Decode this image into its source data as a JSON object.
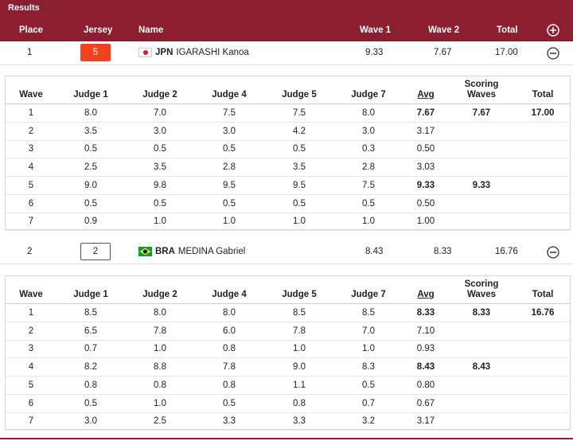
{
  "results_bar": {
    "title": "Results",
    "headers": {
      "place": "Place",
      "jersey": "Jersey",
      "name": "Name",
      "wave1": "Wave 1",
      "wave2": "Wave 2",
      "total": "Total"
    },
    "accent_color": "#8b1f30"
  },
  "athletes": [
    {
      "place": "1",
      "jersey": "5",
      "jersey_color": "#f5401e",
      "flag": "jpn-flag-icon",
      "noc": "JPN",
      "name": "IGARASHI Kanoa",
      "wave1": "9.33",
      "wave2": "7.67",
      "total": "17.00",
      "detail": {
        "headers": {
          "wave": "Wave",
          "j1": "Judge 1",
          "j2": "Judge 2",
          "j4": "Judge 4",
          "j5": "Judge 5",
          "j7": "Judge 7",
          "avg": "Avg",
          "scoring_line1": "Scoring",
          "scoring_line2": "Waves",
          "total": "Total"
        },
        "rows": [
          {
            "wave": "1",
            "j1": "8.0",
            "j2": "7.0",
            "j4": "7.5",
            "j5": "7.5",
            "j7": "8.0",
            "avg": "7.67",
            "scoring": "7.67",
            "total": "17.00"
          },
          {
            "wave": "2",
            "j1": "3.5",
            "j2": "3.0",
            "j4": "3.0",
            "j5": "4.2",
            "j7": "3.0",
            "avg": "3.17",
            "scoring": "",
            "total": ""
          },
          {
            "wave": "3",
            "j1": "0.5",
            "j2": "0.5",
            "j4": "0.5",
            "j5": "0.5",
            "j7": "0.3",
            "avg": "0.50",
            "scoring": "",
            "total": ""
          },
          {
            "wave": "4",
            "j1": "2.5",
            "j2": "3.5",
            "j4": "2.8",
            "j5": "3.5",
            "j7": "2.8",
            "avg": "3.03",
            "scoring": "",
            "total": ""
          },
          {
            "wave": "5",
            "j1": "9.0",
            "j2": "9.8",
            "j4": "9.5",
            "j5": "9.5",
            "j7": "7.5",
            "avg": "9.33",
            "scoring": "9.33",
            "total": ""
          },
          {
            "wave": "6",
            "j1": "0.5",
            "j2": "0.5",
            "j4": "0.5",
            "j5": "0.5",
            "j7": "0.5",
            "avg": "0.50",
            "scoring": "",
            "total": ""
          },
          {
            "wave": "7",
            "j1": "0.9",
            "j2": "1.0",
            "j4": "1.0",
            "j5": "1.0",
            "j7": "1.0",
            "avg": "1.00",
            "scoring": "",
            "total": ""
          }
        ]
      }
    },
    {
      "place": "2",
      "jersey": "2",
      "jersey_color": "#ffffff",
      "flag": "bra-flag-icon",
      "noc": "BRA",
      "name": "MEDINA Gabriel",
      "wave1": "8.43",
      "wave2": "8.33",
      "total": "16.76",
      "detail": {
        "headers": {
          "wave": "Wave",
          "j1": "Judge 1",
          "j2": "Judge 2",
          "j4": "Judge 4",
          "j5": "Judge 5",
          "j7": "Judge 7",
          "avg": "Avg",
          "scoring_line1": "Scoring",
          "scoring_line2": "Waves",
          "total": "Total"
        },
        "rows": [
          {
            "wave": "1",
            "j1": "8.5",
            "j2": "8.0",
            "j4": "8.0",
            "j5": "8.5",
            "j7": "8.5",
            "avg": "8.33",
            "scoring": "8.33",
            "total": "16.76"
          },
          {
            "wave": "2",
            "j1": "6.5",
            "j2": "7.8",
            "j4": "6.0",
            "j5": "7.8",
            "j7": "7.0",
            "avg": "7.10",
            "scoring": "",
            "total": ""
          },
          {
            "wave": "3",
            "j1": "0.7",
            "j2": "1.0",
            "j4": "0.8",
            "j5": "1.0",
            "j7": "1.0",
            "avg": "0.93",
            "scoring": "",
            "total": ""
          },
          {
            "wave": "4",
            "j1": "8.2",
            "j2": "8.8",
            "j4": "7.8",
            "j5": "9.0",
            "j7": "8.3",
            "avg": "8.43",
            "scoring": "8.43",
            "total": ""
          },
          {
            "wave": "5",
            "j1": "0.8",
            "j2": "0.8",
            "j4": "0.8",
            "j5": "1.1",
            "j7": "0.5",
            "avg": "0.80",
            "scoring": "",
            "total": ""
          },
          {
            "wave": "6",
            "j1": "0.5",
            "j2": "1.0",
            "j4": "0.5",
            "j5": "0.8",
            "j7": "0.7",
            "avg": "0.67",
            "scoring": "",
            "total": ""
          },
          {
            "wave": "7",
            "j1": "3.0",
            "j2": "2.5",
            "j4": "3.3",
            "j5": "3.3",
            "j7": "3.2",
            "avg": "3.17",
            "scoring": "",
            "total": ""
          }
        ]
      }
    }
  ]
}
